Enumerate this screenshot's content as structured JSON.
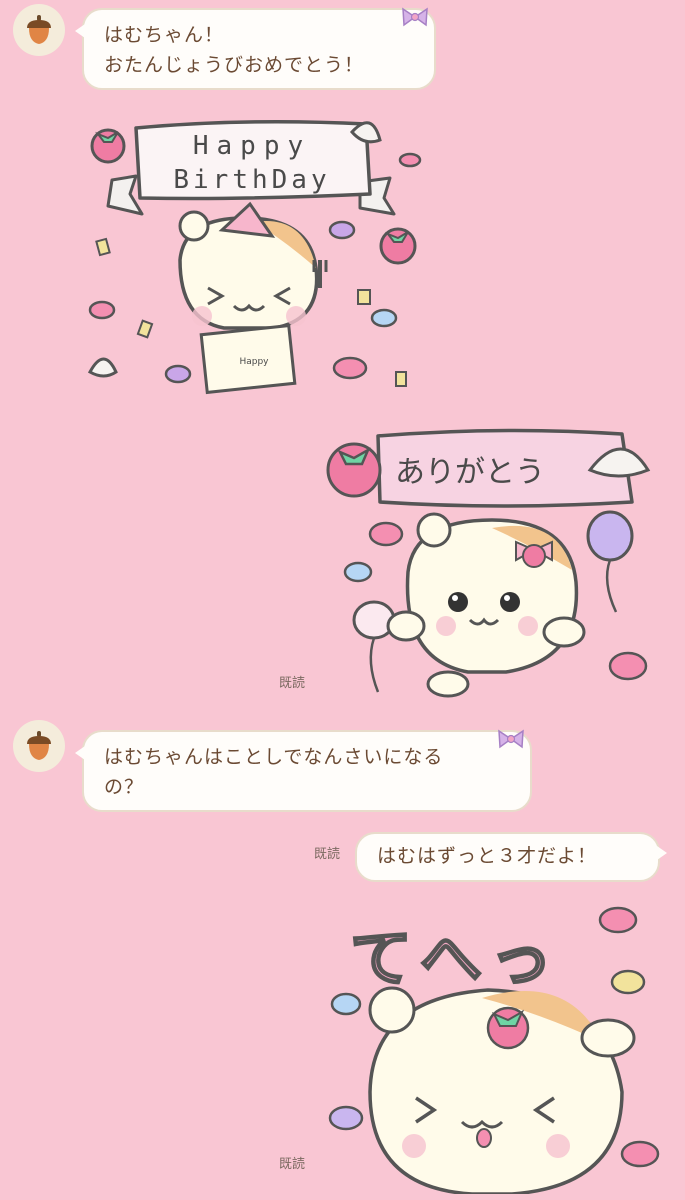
{
  "messages": {
    "m1": {
      "lines": [
        "はむちゃん！",
        "おたんじょうびおめでとう！"
      ]
    },
    "sticker1": {
      "banner_line1": "Happy",
      "banner_line2": "BirthDay",
      "card_text": "Happy"
    },
    "sticker2": {
      "banner": "ありがとう",
      "read": "既読"
    },
    "m2": {
      "lines": [
        "はむちゃんはことしでなんさいになる",
        "の？"
      ]
    },
    "m3": {
      "text": "はむはずっと３才だよ！",
      "read": "既読"
    },
    "sticker3": {
      "title": "てへっ",
      "read": "既読"
    }
  },
  "colors": {
    "background": "#f9c6d3",
    "bubble": "#fffdfa",
    "text": "#6b4a33",
    "read": "#7c6a61"
  },
  "icons": {
    "avatar": "acorn-icon",
    "bubble_decoration": "ribbon-bow-icon"
  }
}
